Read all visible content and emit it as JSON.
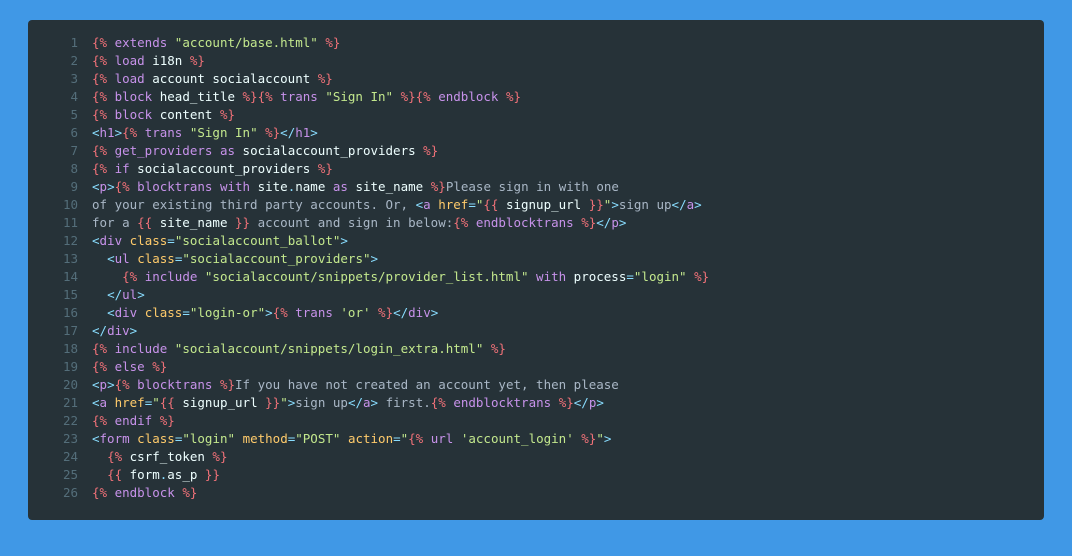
{
  "lines": [
    [
      {
        "c": "tag",
        "t": "{% "
      },
      {
        "c": "kw",
        "t": "extends "
      },
      {
        "c": "str",
        "t": "\"account/base.html\""
      },
      {
        "c": "tag",
        "t": " %}"
      }
    ],
    [
      {
        "c": "tag",
        "t": "{% "
      },
      {
        "c": "kw",
        "t": "load"
      },
      {
        "c": "var",
        "t": " i18n "
      },
      {
        "c": "tag",
        "t": "%}"
      }
    ],
    [
      {
        "c": "tag",
        "t": "{% "
      },
      {
        "c": "kw",
        "t": "load"
      },
      {
        "c": "var",
        "t": " account socialaccount "
      },
      {
        "c": "tag",
        "t": "%}"
      }
    ],
    [
      {
        "c": "tag",
        "t": "{% "
      },
      {
        "c": "kw",
        "t": "block"
      },
      {
        "c": "var",
        "t": " head_title "
      },
      {
        "c": "tag",
        "t": "%}{% "
      },
      {
        "c": "kw",
        "t": "trans "
      },
      {
        "c": "str",
        "t": "\"Sign In\""
      },
      {
        "c": "tag",
        "t": " %}{% "
      },
      {
        "c": "kw",
        "t": "endblock"
      },
      {
        "c": "tag",
        "t": " %}"
      }
    ],
    [
      {
        "c": "tag",
        "t": "{% "
      },
      {
        "c": "kw",
        "t": "block"
      },
      {
        "c": "var",
        "t": " content "
      },
      {
        "c": "tag",
        "t": "%}"
      }
    ],
    [
      {
        "c": "op",
        "t": "<"
      },
      {
        "c": "kw",
        "t": "h1"
      },
      {
        "c": "op",
        "t": ">"
      },
      {
        "c": "tag",
        "t": "{% "
      },
      {
        "c": "kw",
        "t": "trans "
      },
      {
        "c": "str",
        "t": "\"Sign In\""
      },
      {
        "c": "tag",
        "t": " %}"
      },
      {
        "c": "op",
        "t": "</"
      },
      {
        "c": "kw",
        "t": "h1"
      },
      {
        "c": "op",
        "t": ">"
      }
    ],
    [
      {
        "c": "tag",
        "t": "{% "
      },
      {
        "c": "kw",
        "t": "get_providers"
      },
      {
        "c": "var",
        "t": " "
      },
      {
        "c": "kw",
        "t": "as"
      },
      {
        "c": "var",
        "t": " socialaccount_providers "
      },
      {
        "c": "tag",
        "t": "%}"
      }
    ],
    [
      {
        "c": "tag",
        "t": "{% "
      },
      {
        "c": "kw",
        "t": "if"
      },
      {
        "c": "var",
        "t": " socialaccount_providers "
      },
      {
        "c": "tag",
        "t": "%}"
      }
    ],
    [
      {
        "c": "op",
        "t": "<"
      },
      {
        "c": "kw",
        "t": "p"
      },
      {
        "c": "op",
        "t": ">"
      },
      {
        "c": "tag",
        "t": "{% "
      },
      {
        "c": "kw",
        "t": "blocktrans"
      },
      {
        "c": "var",
        "t": " "
      },
      {
        "c": "kw",
        "t": "with"
      },
      {
        "c": "var",
        "t": " site"
      },
      {
        "c": "op",
        "t": "."
      },
      {
        "c": "var",
        "t": "name "
      },
      {
        "c": "kw",
        "t": "as"
      },
      {
        "c": "var",
        "t": " site_name "
      },
      {
        "c": "tag",
        "t": "%}"
      },
      {
        "c": "txt",
        "t": "Please sign in with one"
      }
    ],
    [
      {
        "c": "txt",
        "t": "of your existing third party accounts. Or, "
      },
      {
        "c": "op",
        "t": "<"
      },
      {
        "c": "kw",
        "t": "a"
      },
      {
        "c": "var",
        "t": " "
      },
      {
        "c": "attr",
        "t": "href"
      },
      {
        "c": "op",
        "t": "="
      },
      {
        "c": "str",
        "t": "\""
      },
      {
        "c": "tag",
        "t": "{{ "
      },
      {
        "c": "var",
        "t": "signup_url"
      },
      {
        "c": "tag",
        "t": " }}"
      },
      {
        "c": "str",
        "t": "\""
      },
      {
        "c": "op",
        "t": ">"
      },
      {
        "c": "txt",
        "t": "sign up"
      },
      {
        "c": "op",
        "t": "</"
      },
      {
        "c": "kw",
        "t": "a"
      },
      {
        "c": "op",
        "t": ">"
      }
    ],
    [
      {
        "c": "txt",
        "t": "for a "
      },
      {
        "c": "tag",
        "t": "{{ "
      },
      {
        "c": "var",
        "t": "site_name"
      },
      {
        "c": "tag",
        "t": " }}"
      },
      {
        "c": "txt",
        "t": " account and sign in below:"
      },
      {
        "c": "tag",
        "t": "{% "
      },
      {
        "c": "kw",
        "t": "endblocktrans"
      },
      {
        "c": "tag",
        "t": " %}"
      },
      {
        "c": "op",
        "t": "</"
      },
      {
        "c": "kw",
        "t": "p"
      },
      {
        "c": "op",
        "t": ">"
      }
    ],
    [
      {
        "c": "op",
        "t": "<"
      },
      {
        "c": "kw",
        "t": "div"
      },
      {
        "c": "var",
        "t": " "
      },
      {
        "c": "attr",
        "t": "class"
      },
      {
        "c": "op",
        "t": "="
      },
      {
        "c": "str",
        "t": "\"socialaccount_ballot\""
      },
      {
        "c": "op",
        "t": ">"
      }
    ],
    [
      {
        "c": "txt",
        "t": "  "
      },
      {
        "c": "op",
        "t": "<"
      },
      {
        "c": "kw",
        "t": "ul"
      },
      {
        "c": "var",
        "t": " "
      },
      {
        "c": "attr",
        "t": "class"
      },
      {
        "c": "op",
        "t": "="
      },
      {
        "c": "str",
        "t": "\"socialaccount_providers\""
      },
      {
        "c": "op",
        "t": ">"
      }
    ],
    [
      {
        "c": "txt",
        "t": "    "
      },
      {
        "c": "tag",
        "t": "{% "
      },
      {
        "c": "kw",
        "t": "include "
      },
      {
        "c": "str",
        "t": "\"socialaccount/snippets/provider_list.html\""
      },
      {
        "c": "var",
        "t": " "
      },
      {
        "c": "kw",
        "t": "with"
      },
      {
        "c": "var",
        "t": " process"
      },
      {
        "c": "op",
        "t": "="
      },
      {
        "c": "str",
        "t": "\"login\""
      },
      {
        "c": "tag",
        "t": " %}"
      }
    ],
    [
      {
        "c": "txt",
        "t": "  "
      },
      {
        "c": "op",
        "t": "</"
      },
      {
        "c": "kw",
        "t": "ul"
      },
      {
        "c": "op",
        "t": ">"
      }
    ],
    [
      {
        "c": "txt",
        "t": "  "
      },
      {
        "c": "op",
        "t": "<"
      },
      {
        "c": "kw",
        "t": "div"
      },
      {
        "c": "var",
        "t": " "
      },
      {
        "c": "attr",
        "t": "class"
      },
      {
        "c": "op",
        "t": "="
      },
      {
        "c": "str",
        "t": "\"login-or\""
      },
      {
        "c": "op",
        "t": ">"
      },
      {
        "c": "tag",
        "t": "{% "
      },
      {
        "c": "kw",
        "t": "trans "
      },
      {
        "c": "str",
        "t": "'or'"
      },
      {
        "c": "tag",
        "t": " %}"
      },
      {
        "c": "op",
        "t": "</"
      },
      {
        "c": "kw",
        "t": "div"
      },
      {
        "c": "op",
        "t": ">"
      }
    ],
    [
      {
        "c": "op",
        "t": "</"
      },
      {
        "c": "kw",
        "t": "div"
      },
      {
        "c": "op",
        "t": ">"
      }
    ],
    [
      {
        "c": "tag",
        "t": "{% "
      },
      {
        "c": "kw",
        "t": "include "
      },
      {
        "c": "str",
        "t": "\"socialaccount/snippets/login_extra.html\""
      },
      {
        "c": "tag",
        "t": " %}"
      }
    ],
    [
      {
        "c": "tag",
        "t": "{% "
      },
      {
        "c": "kw",
        "t": "else"
      },
      {
        "c": "tag",
        "t": " %}"
      }
    ],
    [
      {
        "c": "op",
        "t": "<"
      },
      {
        "c": "kw",
        "t": "p"
      },
      {
        "c": "op",
        "t": ">"
      },
      {
        "c": "tag",
        "t": "{% "
      },
      {
        "c": "kw",
        "t": "blocktrans"
      },
      {
        "c": "tag",
        "t": " %}"
      },
      {
        "c": "txt",
        "t": "If you have not created an account yet, then please"
      }
    ],
    [
      {
        "c": "op",
        "t": "<"
      },
      {
        "c": "kw",
        "t": "a"
      },
      {
        "c": "var",
        "t": " "
      },
      {
        "c": "attr",
        "t": "href"
      },
      {
        "c": "op",
        "t": "="
      },
      {
        "c": "str",
        "t": "\""
      },
      {
        "c": "tag",
        "t": "{{ "
      },
      {
        "c": "var",
        "t": "signup_url"
      },
      {
        "c": "tag",
        "t": " }}"
      },
      {
        "c": "str",
        "t": "\""
      },
      {
        "c": "op",
        "t": ">"
      },
      {
        "c": "txt",
        "t": "sign up"
      },
      {
        "c": "op",
        "t": "</"
      },
      {
        "c": "kw",
        "t": "a"
      },
      {
        "c": "op",
        "t": ">"
      },
      {
        "c": "txt",
        "t": " first."
      },
      {
        "c": "tag",
        "t": "{% "
      },
      {
        "c": "kw",
        "t": "endblocktrans"
      },
      {
        "c": "tag",
        "t": " %}"
      },
      {
        "c": "op",
        "t": "</"
      },
      {
        "c": "kw",
        "t": "p"
      },
      {
        "c": "op",
        "t": ">"
      }
    ],
    [
      {
        "c": "tag",
        "t": "{% "
      },
      {
        "c": "kw",
        "t": "endif"
      },
      {
        "c": "tag",
        "t": " %}"
      }
    ],
    [
      {
        "c": "op",
        "t": "<"
      },
      {
        "c": "kw",
        "t": "form"
      },
      {
        "c": "var",
        "t": " "
      },
      {
        "c": "attr",
        "t": "class"
      },
      {
        "c": "op",
        "t": "="
      },
      {
        "c": "str",
        "t": "\"login\""
      },
      {
        "c": "var",
        "t": " "
      },
      {
        "c": "attr",
        "t": "method"
      },
      {
        "c": "op",
        "t": "="
      },
      {
        "c": "str",
        "t": "\"POST\""
      },
      {
        "c": "var",
        "t": " "
      },
      {
        "c": "attr",
        "t": "action"
      },
      {
        "c": "op",
        "t": "="
      },
      {
        "c": "str",
        "t": "\""
      },
      {
        "c": "tag",
        "t": "{% "
      },
      {
        "c": "kw",
        "t": "url "
      },
      {
        "c": "str",
        "t": "'account_login'"
      },
      {
        "c": "tag",
        "t": " %}"
      },
      {
        "c": "str",
        "t": "\""
      },
      {
        "c": "op",
        "t": ">"
      }
    ],
    [
      {
        "c": "txt",
        "t": "  "
      },
      {
        "c": "tag",
        "t": "{% "
      },
      {
        "c": "var",
        "t": "csrf_token"
      },
      {
        "c": "tag",
        "t": " %}"
      }
    ],
    [
      {
        "c": "txt",
        "t": "  "
      },
      {
        "c": "tag",
        "t": "{{ "
      },
      {
        "c": "var",
        "t": "form"
      },
      {
        "c": "op",
        "t": "."
      },
      {
        "c": "var",
        "t": "as_p"
      },
      {
        "c": "tag",
        "t": " }}"
      }
    ],
    [
      {
        "c": "tag",
        "t": "{% "
      },
      {
        "c": "kw",
        "t": "endblock"
      },
      {
        "c": "tag",
        "t": " %}"
      }
    ]
  ]
}
